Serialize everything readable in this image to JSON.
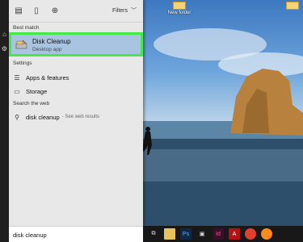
{
  "menu": {
    "filters_label": "Filters",
    "best_match_label": "Best match",
    "best_match": {
      "title": "Disk Cleanup",
      "subtitle": "Desktop app"
    },
    "settings_label": "Settings",
    "settings": [
      {
        "label": "Apps & features",
        "icon": "apps-features-icon"
      },
      {
        "label": "Storage",
        "icon": "storage-icon"
      }
    ],
    "web_label": "Search the web",
    "web_result": {
      "query": "disk cleanup",
      "hint": "- See web results"
    }
  },
  "search": {
    "value": "disk cleanup"
  },
  "desktop": {
    "icons": [
      {
        "label": "New folder"
      }
    ]
  },
  "taskbar": {
    "icons": [
      "task-view-icon",
      "file-explorer-icon",
      "photoshop-icon",
      "store-icon",
      "indesign-icon",
      "acrobat-icon",
      "chrome-icon",
      "firefox-icon"
    ]
  },
  "colors": {
    "accent": "#a8c4e0",
    "highlight": "#45e94a",
    "panel": "#e8e8e8",
    "taskbar": "#181818"
  }
}
